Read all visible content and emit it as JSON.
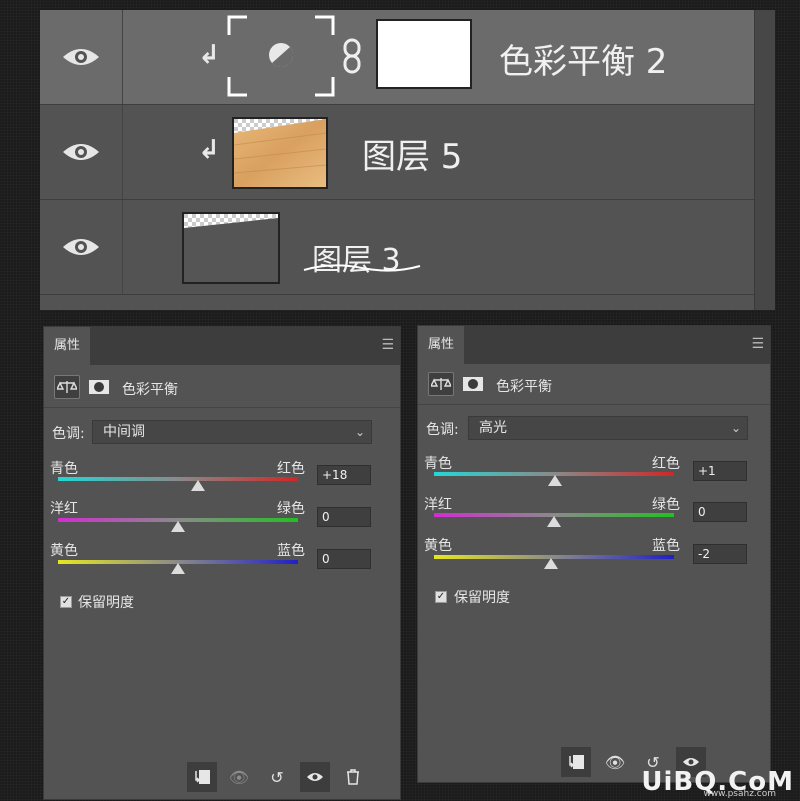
{
  "layers": [
    {
      "name": "色彩平衡 2",
      "selected": true,
      "type": "adjustment"
    },
    {
      "name": "图层 5",
      "selected": false,
      "type": "image"
    },
    {
      "name": "图层 3",
      "selected": false,
      "type": "image"
    }
  ],
  "panel_left": {
    "tab": "属性",
    "title": "色彩平衡",
    "tone_label": "色调:",
    "tone_value": "中间调",
    "sliders": [
      {
        "left": "青色",
        "right": "红色",
        "value": "+18",
        "fraction": 0.59
      },
      {
        "left": "洋红",
        "right": "绿色",
        "value": "0",
        "fraction": 0.5
      },
      {
        "left": "黄色",
        "right": "蓝色",
        "value": "0",
        "fraction": 0.5
      }
    ],
    "preserve_label": "保留明度",
    "preserve_checked": true
  },
  "panel_right": {
    "tab": "属性",
    "title": "色彩平衡",
    "tone_label": "色调:",
    "tone_value": "高光",
    "sliders": [
      {
        "left": "青色",
        "right": "红色",
        "value": "+1",
        "fraction": 0.5
      },
      {
        "left": "洋红",
        "right": "绿色",
        "value": "0",
        "fraction": 0.5
      },
      {
        "left": "黄色",
        "right": "蓝色",
        "value": "-2",
        "fraction": 0.49
      }
    ],
    "preserve_label": "保留明度",
    "preserve_checked": true
  },
  "watermark": "UiBQ.CoM",
  "watermark_sub": "www.psahz.com",
  "colors": {
    "panel_bg": "#535353",
    "selected_row": "#6b6b6b",
    "cyan_red": [
      "#23d7d7",
      "#d02626"
    ],
    "magenta_green": [
      "#d12dd1",
      "#22c022"
    ],
    "yellow_blue": [
      "#e6e620",
      "#2020c8"
    ]
  }
}
